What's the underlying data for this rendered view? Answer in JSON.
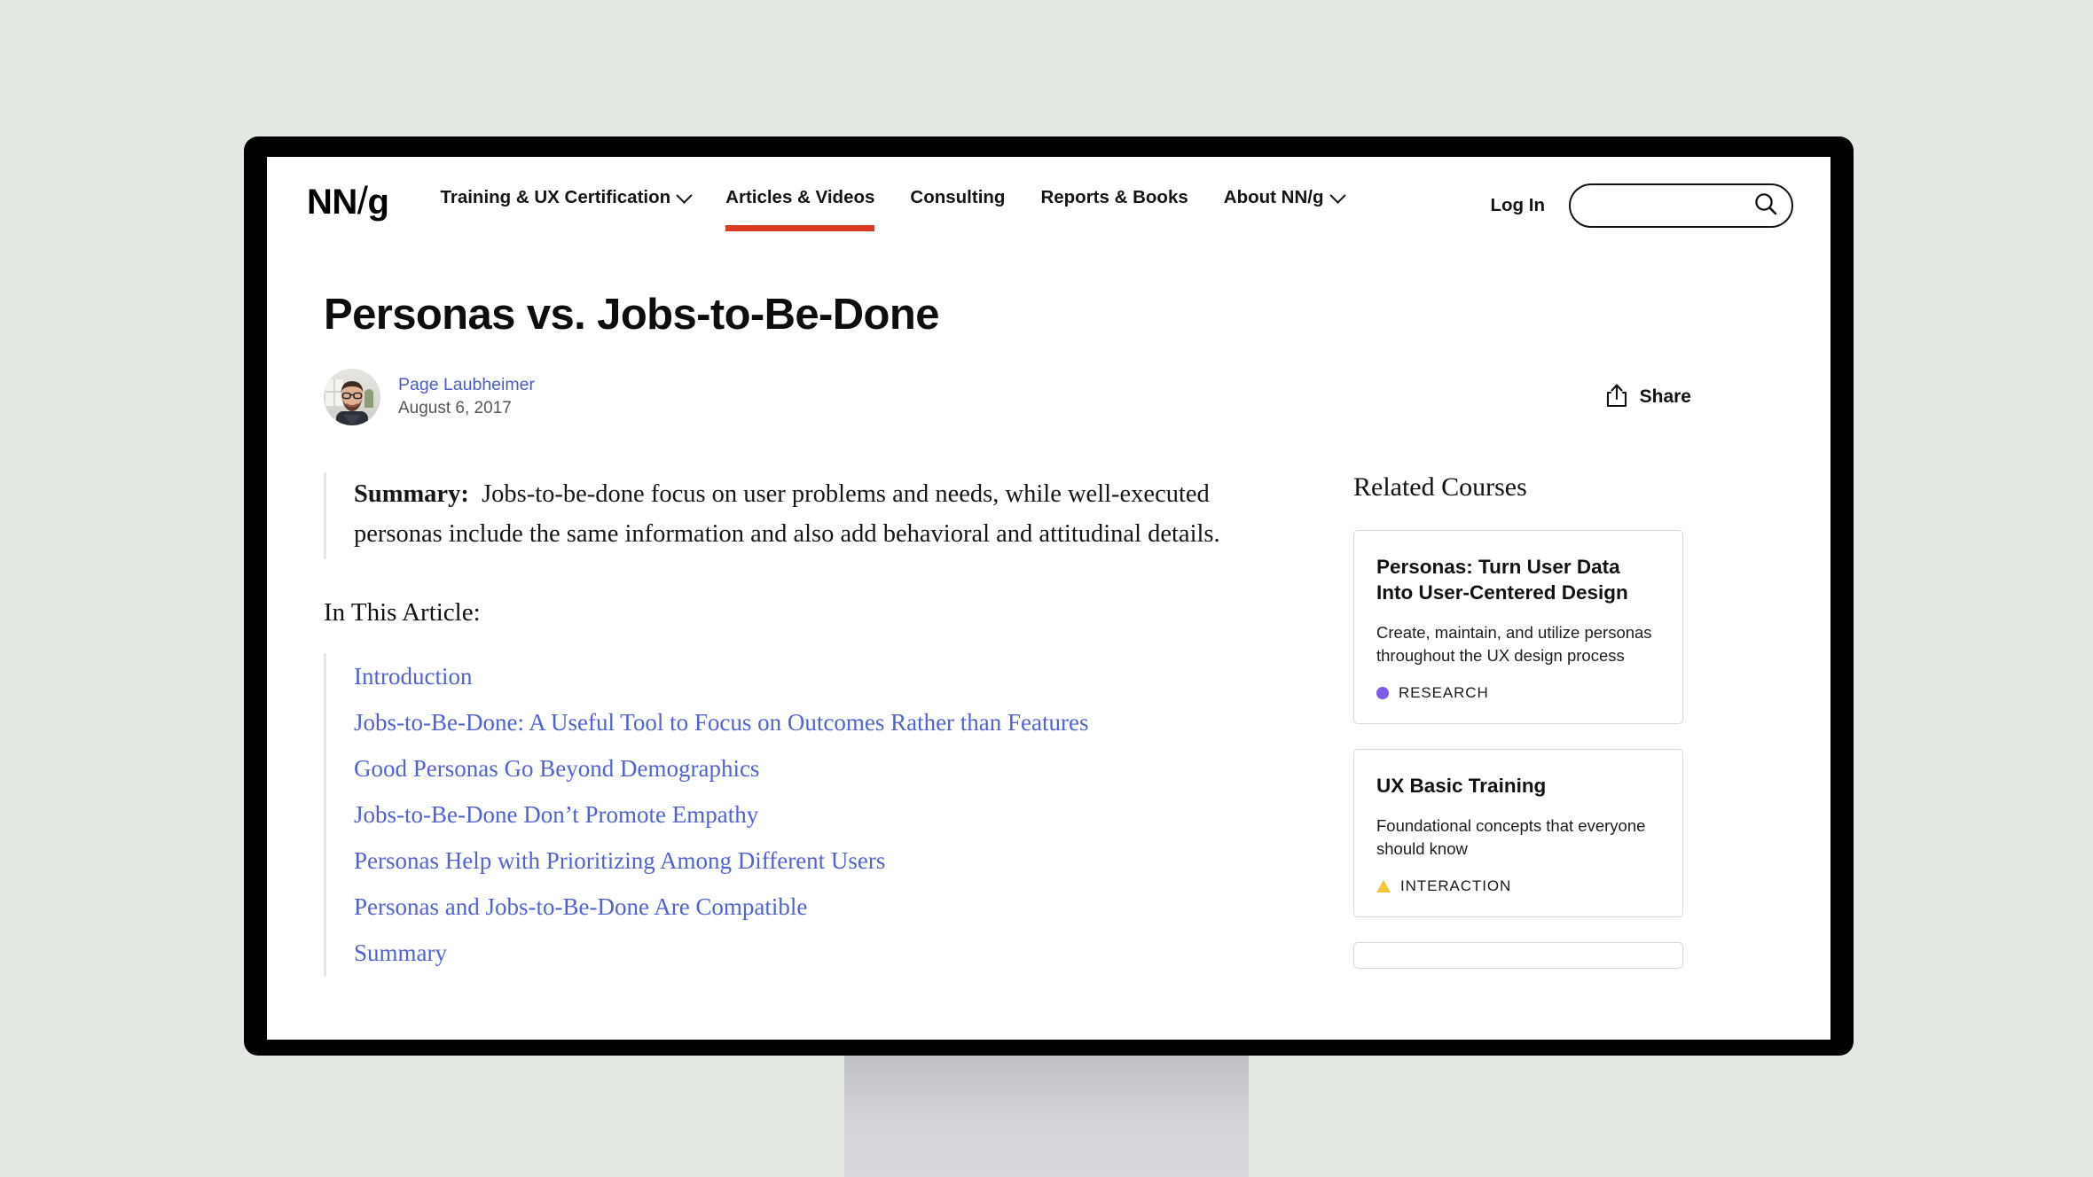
{
  "header": {
    "logo": {
      "nn": "NN",
      "slash": "/",
      "g": "g"
    },
    "nav": [
      {
        "label": "Training & UX Certification",
        "has_chevron": true,
        "active": false
      },
      {
        "label": "Articles & Videos",
        "has_chevron": false,
        "active": true
      },
      {
        "label": "Consulting",
        "has_chevron": false,
        "active": false
      },
      {
        "label": "Reports & Books",
        "has_chevron": false,
        "active": false
      },
      {
        "label": "About NN/g",
        "has_chevron": true,
        "active": false
      }
    ],
    "nav_labels": {
      "training": "Training & UX Certification",
      "articles": "Articles & Videos",
      "consulting": "Consulting",
      "reports": "Reports & Books",
      "about": "About NN/g"
    },
    "login_label": "Log In",
    "search_placeholder": "",
    "search_value": "",
    "accent_color": "#dc3a24"
  },
  "article": {
    "title": "Personas vs. Jobs-to-Be-Done",
    "author": "Page Laubheimer",
    "date": "August 6, 2017",
    "share_label": "Share",
    "summary_label": "Summary:",
    "summary_body": "Jobs-to-be-done focus on user problems and needs, while well-executed personas include the same information and also add behavioral and attitudinal details.",
    "toc_heading": "In This Article:",
    "toc": [
      "Introduction",
      "Jobs-to-Be-Done: A Useful Tool to Focus on Outcomes Rather than Features",
      "Good Personas Go Beyond Demographics",
      "Jobs-to-Be-Done Don’t Promote Empathy",
      "Personas Help with Prioritizing Among Different Users",
      "Personas and Jobs-to-Be-Done Are Compatible",
      "Summary"
    ]
  },
  "sidebar": {
    "title": "Related Courses",
    "courses": [
      {
        "title": "Personas: Turn User Data Into User-Centered Design",
        "desc": "Create, maintain, and utilize personas throughout the UX design process",
        "tag": "RESEARCH",
        "tag_shape": "dot",
        "tag_color": "#7b5be8"
      },
      {
        "title": "UX Basic Training",
        "desc": "Foundational concepts that everyone should know",
        "tag": "INTERACTION",
        "tag_shape": "triangle",
        "tag_color": "#f5c53b"
      }
    ]
  },
  "colors": {
    "page_background": "#e3e8e2",
    "bezel": "#000000",
    "link_blue": "#5163d3",
    "author_blue": "#4a5bd0",
    "stand_top": "#bcbec1",
    "stand_bottom": "#d9d9dd"
  }
}
